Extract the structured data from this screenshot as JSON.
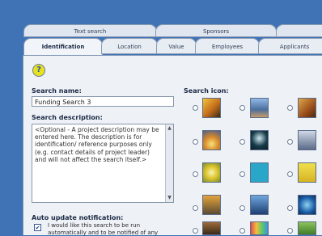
{
  "tabs_upper": [
    "Text search",
    "Sponsors"
  ],
  "tabs_lower": [
    "Identification",
    "Location",
    "Value",
    "Employees",
    "Applicants"
  ],
  "active_tab": "Identification",
  "form": {
    "search_name_label": "Search name:",
    "search_name_value": "Funding Search 3",
    "search_description_label": "Search description:",
    "search_description_value": "<Optional - A project description may be entered here. The description is for identification/ reference purposes only (e.g. contact details of project leader) and will not affect the search itself.>",
    "search_icon_label": "Search icon:",
    "auto_update_label": "Auto update notification:",
    "auto_update_text": "I would like this search to be run automatically and to be notified of any"
  },
  "icons": {
    "help": "help-question-icon",
    "grid": [
      [
        "tree-sunset-icon",
        "figure-sky-icon",
        "hands-icon"
      ],
      [
        "sunrise-icon",
        "keyhole-icon",
        "runner-icon"
      ],
      [
        "flower-icon",
        "cross-icon",
        "figure-yellow-icon"
      ],
      [
        "city-icon",
        "tower-icon",
        "globe-icon"
      ],
      [
        "stairs-icon",
        "rainbow-icon",
        "leaf-icon"
      ]
    ]
  },
  "colors": {
    "background": "#3f73b6",
    "panel": "#eef2f7",
    "tab_active": "#f1f4f8",
    "tab_inactive": "#dfe6f0",
    "accent": "#2d4fb8"
  }
}
